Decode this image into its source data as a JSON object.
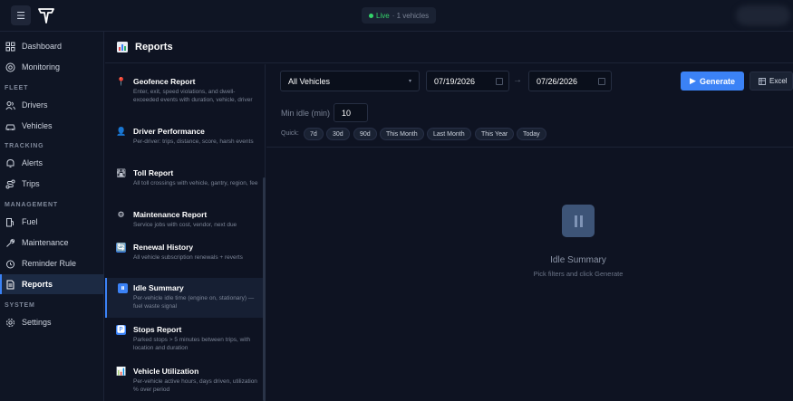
{
  "topbar": {
    "live_label": "Live",
    "vehicle_count": "· 1 vehicles"
  },
  "sidebar": {
    "items": [
      {
        "label": "Dashboard",
        "icon": "grid-icon"
      },
      {
        "label": "Monitoring",
        "icon": "radar-icon"
      },
      {
        "label": "Drivers",
        "icon": "users-icon"
      },
      {
        "label": "Vehicles",
        "icon": "car-icon"
      },
      {
        "label": "Alerts",
        "icon": "bell-icon"
      },
      {
        "label": "Trips",
        "icon": "route-icon"
      },
      {
        "label": "Fuel",
        "icon": "fuel-icon"
      },
      {
        "label": "Maintenance",
        "icon": "wrench-icon"
      },
      {
        "label": "Reminder Rule",
        "icon": "alarm-icon"
      },
      {
        "label": "Reports",
        "icon": "report-icon"
      },
      {
        "label": "Settings",
        "icon": "gear-icon"
      }
    ],
    "sections": [
      "FLEET",
      "TRACKING",
      "MANAGEMENT",
      "SYSTEM"
    ]
  },
  "header": {
    "title": "Reports"
  },
  "reports": [
    {
      "title": "Geofence Report",
      "desc": "Enter, exit, speed violations, and dwell-exceeded events with duration, vehicle, driver",
      "icon": "📍"
    },
    {
      "title": "Driver Performance",
      "desc": "Per-driver: trips, distance, score, harsh events",
      "icon": "👤"
    },
    {
      "title": "Toll Report",
      "desc": "All toll crossings with vehicle, gantry, region, fee",
      "icon": "🛣"
    },
    {
      "title": "Maintenance Report",
      "desc": "Service jobs with cost, vendor, next due",
      "icon": "⚙"
    },
    {
      "title": "Renewal History",
      "desc": "All vehicle subscription renewals + reverts",
      "icon": "🔄"
    },
    {
      "title": "Idle Summary",
      "desc": "Per-vehicle idle time (engine on, stationary) — fuel waste signal",
      "icon": "⏸"
    },
    {
      "title": "Stops Report",
      "desc": "Parked stops > 5 minutes between trips, with location and duration",
      "icon": "🅿"
    },
    {
      "title": "Vehicle Utilization",
      "desc": "Per-vehicle active hours, days driven, utilization % over period",
      "icon": "📊"
    }
  ],
  "filters": {
    "vehicle": "All Vehicles",
    "date_from": "07/19/2026",
    "date_to": "07/26/2026",
    "arrow": "→",
    "generate": "Generate",
    "excel": "Excel",
    "min_idle_label": "Min idle (min)",
    "min_idle_value": "10",
    "quick_label": "Quick:",
    "quick": [
      "7d",
      "30d",
      "90d",
      "This Month",
      "Last Month",
      "This Year",
      "Today"
    ]
  },
  "empty_state": {
    "title": "Idle Summary",
    "subtitle": "Pick filters and click Generate"
  },
  "colors": {
    "accent": "#3b82f6",
    "live": "#34d36a",
    "background": "#0e1322"
  }
}
